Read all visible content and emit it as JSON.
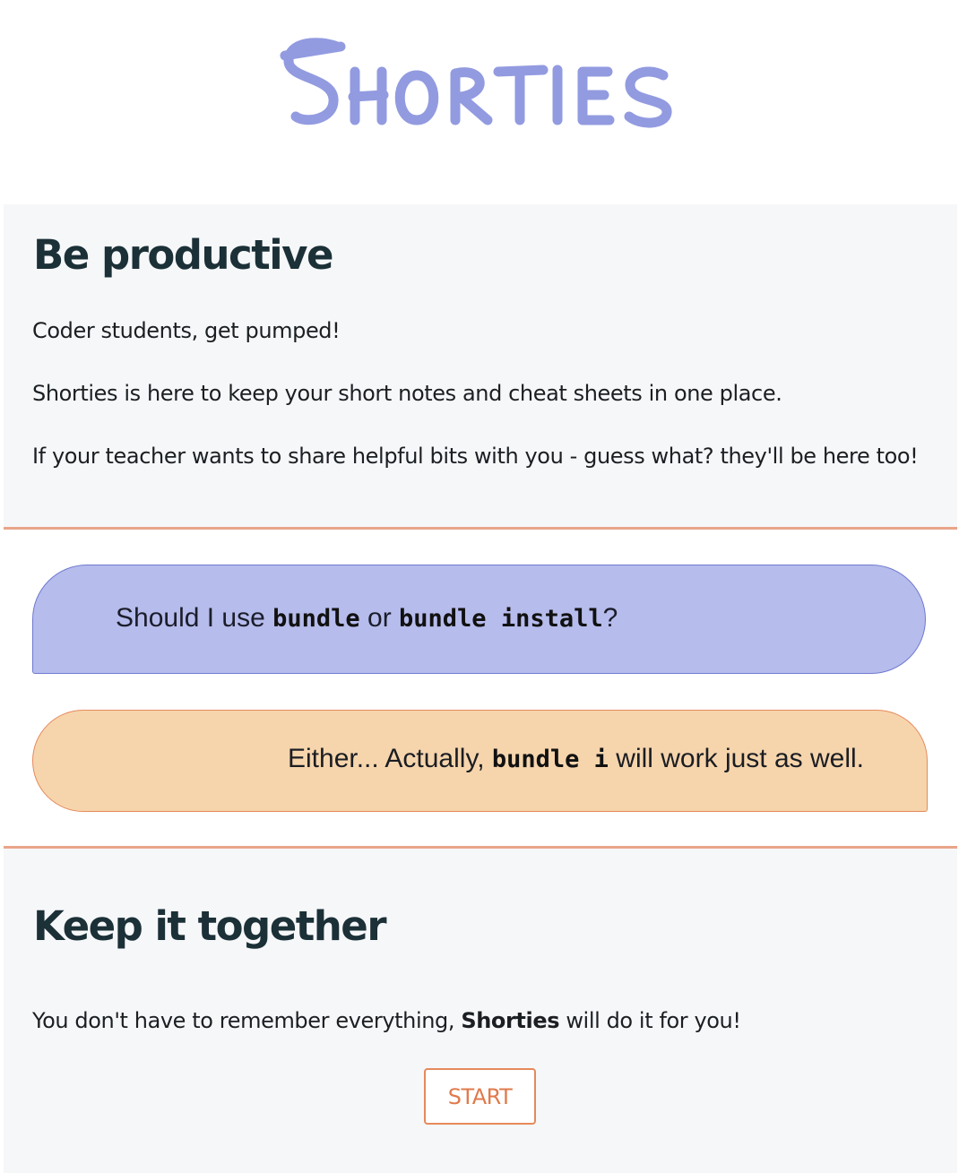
{
  "header": {
    "logo_text": "Shorties",
    "logo_color": "#8d96df"
  },
  "productive": {
    "title": "Be productive",
    "p1": "Coder students, get pumped!",
    "p2": "Shorties is here to keep your short notes and cheat sheets in one place.",
    "p3": "If your teacher wants to share helpful bits with you - guess what? they'll be here too!"
  },
  "chat": {
    "question": {
      "before": "Should I use ",
      "code1": "bundle",
      "middle": " or ",
      "code2": "bundle install",
      "after": "?"
    },
    "answer": {
      "before": "Either... Actually, ",
      "code": "bundle i",
      "after": " will work just as well."
    }
  },
  "together": {
    "title": "Keep it together",
    "text_before": "You don't have to remember everything, ",
    "brand": "Shorties",
    "text_after": " will do it for you!",
    "start_label": "START"
  },
  "colors": {
    "accent_orange": "#e58a5b",
    "divider": "#e9a58a",
    "question_bg": "#b6bcec",
    "answer_bg": "#f6d5ad",
    "section_bg": "#f6f7f9"
  }
}
